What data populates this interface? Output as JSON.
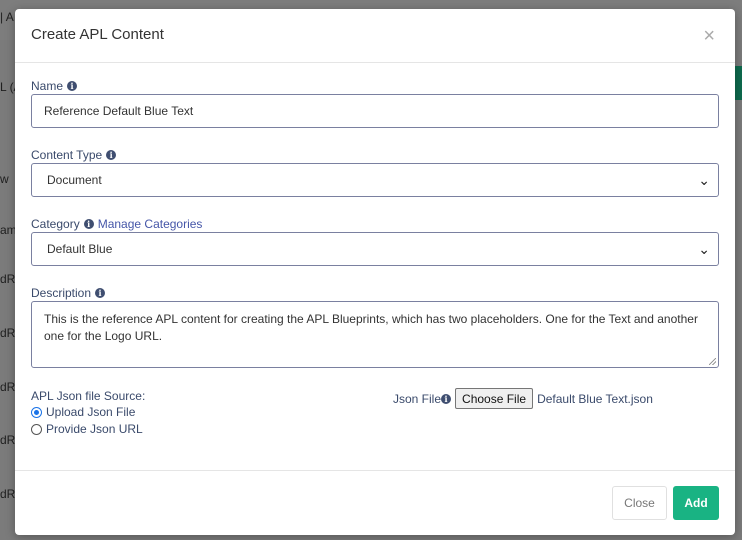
{
  "background": {
    "top_fragment": "| A",
    "left_fragments": [
      "L (A",
      "w",
      "ame",
      "dR",
      "dR",
      "dR",
      "dR",
      "dR"
    ]
  },
  "modal": {
    "title": "Create APL Content",
    "close_glyph": "×",
    "name": {
      "label": "Name",
      "value": "Reference Default Blue Text"
    },
    "content_type": {
      "label": "Content Type",
      "selected": "Document"
    },
    "category": {
      "label": "Category",
      "manage_link": "Manage Categories",
      "selected": "Default Blue"
    },
    "description": {
      "label": "Description",
      "value": "This is the reference APL content for creating the APL Blueprints, which has two placeholders. One for the Text and another one for the Logo URL."
    },
    "source": {
      "label": "APL Json file Source:",
      "options": [
        {
          "label": "Upload Json File",
          "checked": true
        },
        {
          "label": "Provide Json URL",
          "checked": false
        }
      ]
    },
    "json_file": {
      "label": "Json File",
      "button": "Choose File",
      "file_name": "Default Blue Text.json"
    },
    "footer": {
      "close_label": "Close",
      "add_label": "Add"
    }
  },
  "colors": {
    "accent": "#19b383",
    "label": "#3a4a6b",
    "link": "#4556a8"
  }
}
